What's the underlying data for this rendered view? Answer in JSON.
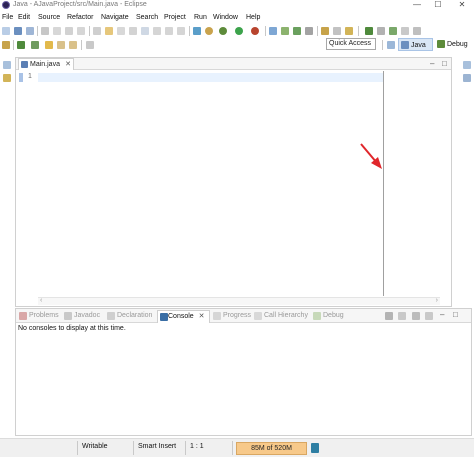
{
  "window": {
    "title": "Java - AJavaProject/src/Main.java - Eclipse",
    "controls": {
      "minimize": "—",
      "maximize": "☐",
      "close": "✕"
    }
  },
  "menu": [
    "File",
    "Edit",
    "Source",
    "Refactor",
    "Navigate",
    "Search",
    "Project",
    "Run",
    "Window",
    "Help"
  ],
  "quick_access": {
    "label": "Quick Access"
  },
  "perspectives": {
    "java": "Java",
    "debug": "Debug"
  },
  "editor": {
    "tab_label": "Main.java",
    "tab_close": "✕",
    "line_numbers": [
      "1"
    ],
    "minimize": "–",
    "maximize": "□"
  },
  "bottom_panel": {
    "tabs": [
      "Problems",
      "Javadoc",
      "Declaration",
      "Console",
      "Progress",
      "Call Hierarchy",
      "Debug"
    ],
    "active_tab": "Console",
    "console_close": "✕",
    "console_message": "No consoles to display at this time."
  },
  "status_bar": {
    "writable": "Writable",
    "insert_mode": "Smart Insert",
    "position": "1 : 1",
    "heap": "85M of 520M",
    "heap_fraction": 0.16
  },
  "colors": {
    "accent": "#a9c4e6",
    "heap_bar": "#f7c98a",
    "annotation_arrow": "#e0262b"
  }
}
